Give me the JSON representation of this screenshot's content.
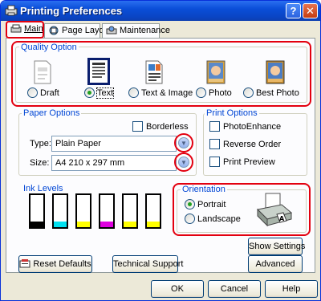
{
  "window": {
    "title": "Printing Preferences",
    "help_glyph": "?",
    "close_glyph": "✕"
  },
  "tabs": [
    {
      "label": "Main"
    },
    {
      "label": "Page Layout"
    },
    {
      "label": "Maintenance"
    }
  ],
  "quality": {
    "label": "Quality Option",
    "options": [
      {
        "label": "Draft",
        "selected": false
      },
      {
        "label": "Text",
        "selected": true
      },
      {
        "label": "Text & Image",
        "selected": false
      },
      {
        "label": "Photo",
        "selected": false
      },
      {
        "label": "Best Photo",
        "selected": false
      }
    ]
  },
  "paper": {
    "label": "Paper Options",
    "borderless": "Borderless",
    "type_label": "Type:",
    "type_value": "Plain Paper",
    "size_label": "Size:",
    "size_value": "A4 210 x 297 mm"
  },
  "print_options": {
    "label": "Print Options",
    "items": [
      {
        "label": "PhotoEnhance",
        "checked": false
      },
      {
        "label": "Reverse Order",
        "checked": false
      },
      {
        "label": "Print Preview",
        "checked": false
      }
    ]
  },
  "ink": {
    "label": "Ink Levels",
    "cartridges": [
      {
        "color": "#000000"
      },
      {
        "color": "#00e0f0"
      },
      {
        "color": "#ffff00"
      },
      {
        "color": "#e000e0"
      },
      {
        "color": "#ffff00"
      },
      {
        "color": "#ffff00"
      }
    ]
  },
  "orientation": {
    "label": "Orientation",
    "options": [
      {
        "label": "Portrait",
        "selected": true
      },
      {
        "label": "Landscape",
        "selected": false
      }
    ]
  },
  "buttons": {
    "show_settings": "Show Settings",
    "reset_defaults": "Reset Defaults",
    "technical_support": "Technical Support",
    "advanced": "Advanced",
    "ok": "OK",
    "cancel": "Cancel",
    "help": "Help"
  },
  "colors": {
    "highlight_red": "#e3000f",
    "group_label_blue": "#0046d5",
    "titlebar_blue": "#0a4ed8"
  }
}
